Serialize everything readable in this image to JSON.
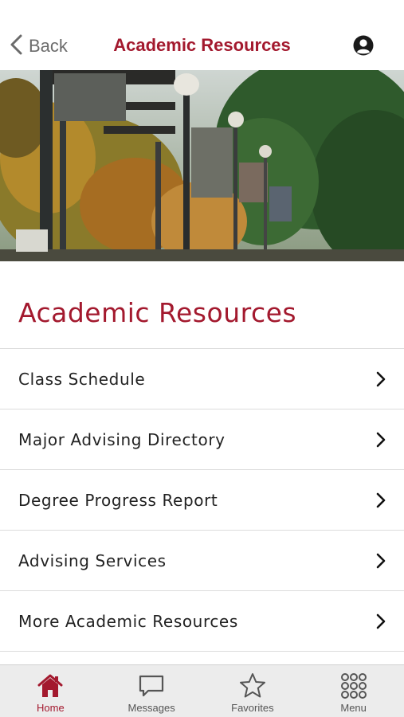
{
  "header": {
    "back_label": "Back",
    "title": "Academic Resources"
  },
  "hero": {
    "image": "campus-walkway-photo"
  },
  "section": {
    "heading": "Academic Resources"
  },
  "resources": [
    {
      "label": "Class Schedule"
    },
    {
      "label": "Major Advising Directory"
    },
    {
      "label": "Degree Progress Report"
    },
    {
      "label": "Advising Services"
    },
    {
      "label": "More Academic Resources"
    }
  ],
  "tabbar": {
    "tabs": [
      {
        "label": "Home",
        "icon": "home-icon",
        "active": true
      },
      {
        "label": "Messages",
        "icon": "message-icon",
        "active": false
      },
      {
        "label": "Favorites",
        "icon": "star-icon",
        "active": false
      },
      {
        "label": "Menu",
        "icon": "grid-menu-icon",
        "active": false
      }
    ]
  },
  "colors": {
    "brand": "#a3192e",
    "tabbar_bg": "#ececec",
    "divider": "#dcdcdc"
  }
}
